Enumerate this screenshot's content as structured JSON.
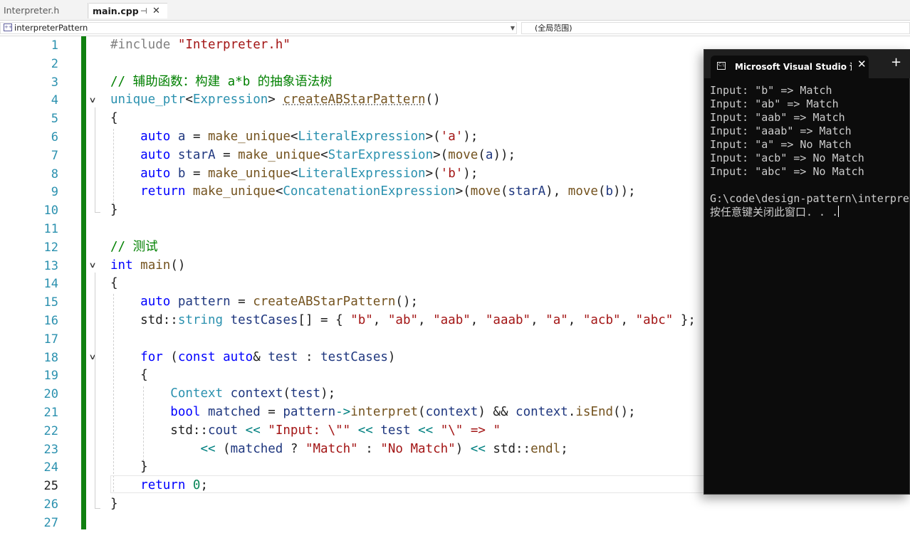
{
  "tabs": [
    {
      "label": "Interpreter.h",
      "active": false
    },
    {
      "label": "main.cpp",
      "active": true,
      "pin": "⊣",
      "close": "✕"
    }
  ],
  "navbar": {
    "scope_left": "interpreterPattern",
    "scope_right": "(全局范围)"
  },
  "editor": {
    "line_numbers": [
      "1",
      "2",
      "3",
      "4",
      "5",
      "6",
      "7",
      "8",
      "9",
      "10",
      "11",
      "12",
      "13",
      "14",
      "15",
      "16",
      "17",
      "18",
      "19",
      "20",
      "21",
      "22",
      "23",
      "24",
      "25",
      "26",
      "27"
    ],
    "current_line": "25",
    "code": {
      "l1_directive": "#include",
      "l1_file": "\"Interpreter.h\"",
      "l3_comment": "// 辅助函数：构建 a*b 的抽象语法树",
      "l4_type1": "unique_ptr",
      "l4_type2": "Expression",
      "l4_fn": "createABStarPattern",
      "l6_type": "LiteralExpression",
      "l6_char": "'a'",
      "l7_type": "StarExpression",
      "l8_type": "LiteralExpression",
      "l8_char": "'b'",
      "l9_type": "ConcatenationExpression",
      "l12_comment": "// 测试",
      "l16_cases": [
        "\"b\"",
        "\"ab\"",
        "\"aab\"",
        "\"aaab\"",
        "\"a\"",
        "\"acb\"",
        "\"abc\""
      ],
      "l22_str1": "\"Input: \\\"\"",
      "l22_str2": "\"\\\" => \"",
      "l23_str1": "\"Match\"",
      "l23_str2": "\"No Match\"",
      "l25_num": "0"
    }
  },
  "console": {
    "title": "Microsoft Visual Studio 调试控制台",
    "close": "✕",
    "plus": "+",
    "lines": [
      "Input: \"b\" => Match",
      "Input: \"ab\" => Match",
      "Input: \"aab\" => Match",
      "Input: \"aaab\" => Match",
      "Input: \"a\" => No Match",
      "Input: \"acb\" => No Match",
      "Input: \"abc\" => No Match",
      "",
      "G:\\code\\design-pattern\\interpreter",
      "按任意键关闭此窗口. . ."
    ]
  },
  "colors": {
    "keyword": "#0000ff",
    "type": "#2b91af",
    "string": "#a31515",
    "comment": "#008000",
    "line_number": "#2b91af",
    "change_bar": "#108010",
    "console_bg": "#0c0c0c"
  }
}
